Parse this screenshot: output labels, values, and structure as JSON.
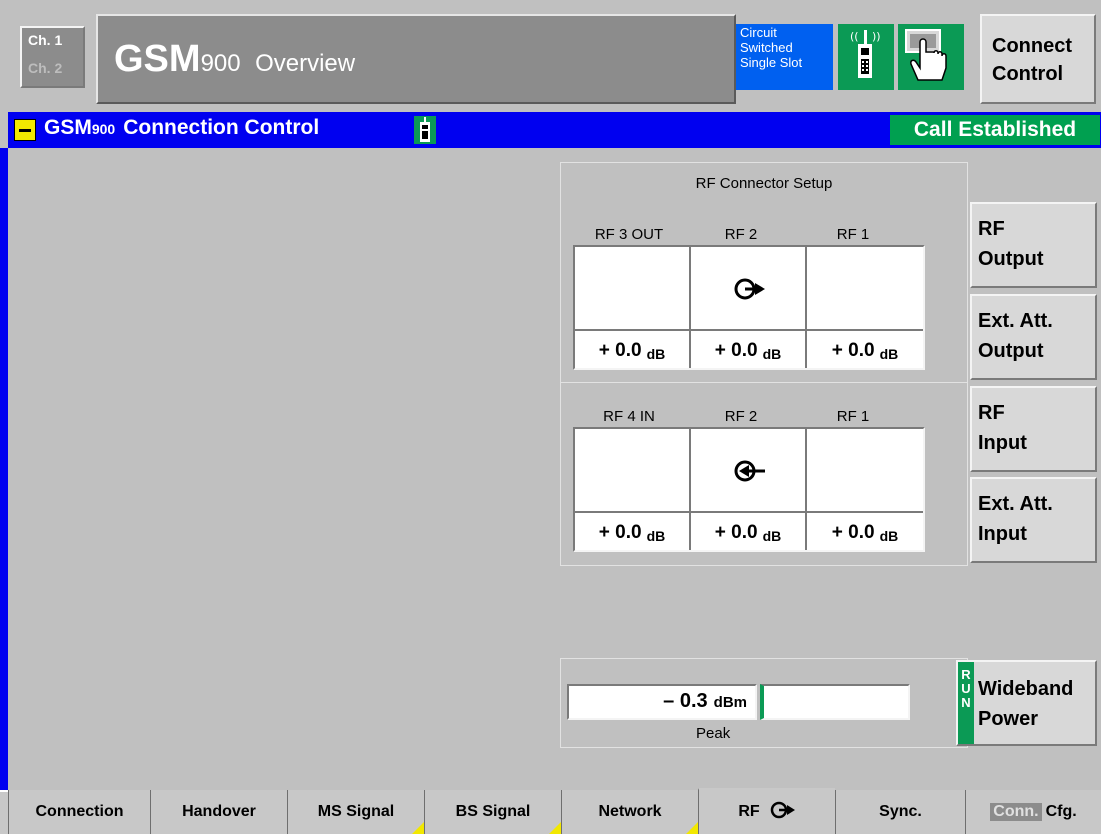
{
  "header": {
    "ch1": "Ch. 1",
    "ch2": "Ch. 2",
    "app_main": "GSM",
    "app_band": "900",
    "app_view": "Overview",
    "mode_line1": "Circuit",
    "mode_line2": "Switched",
    "mode_line3": "Single Slot",
    "connect_line1": "Connect",
    "connect_line2": "Control"
  },
  "title_bar": {
    "menu_icon": "minus-icon",
    "text_main": "GSM",
    "text_band": "900",
    "text_rest": "Connection Control",
    "status": "Call Established"
  },
  "rf_setup": {
    "title": "RF Connector Setup",
    "output": {
      "headers": [
        "RF 3 OUT",
        "RF 2",
        "RF 1"
      ],
      "values": [
        "+ 0.0",
        "+ 0.0",
        "+ 0.0"
      ],
      "unit": "dB",
      "active_connector_icon": "rf-output-connector-icon"
    },
    "input": {
      "headers": [
        "RF 4 IN",
        "RF 2",
        "RF 1"
      ],
      "values": [
        "+ 0.0",
        "+ 0.0",
        "+ 0.0"
      ],
      "unit": "dB",
      "active_connector_icon": "rf-input-connector-icon"
    }
  },
  "softkeys": {
    "rf_output": [
      "RF",
      "Output"
    ],
    "ext_att_output": [
      "Ext. Att.",
      "Output"
    ],
    "rf_input": [
      "RF",
      "Input"
    ],
    "ext_att_input": [
      "Ext. Att.",
      "Input"
    ],
    "wideband": [
      "Wideband",
      "Power"
    ],
    "run_letters": [
      "R",
      "U",
      "N"
    ]
  },
  "power": {
    "value": "– 0.3",
    "unit": "dBm",
    "label": "Peak",
    "second_value": ""
  },
  "tabs": [
    {
      "label": "Connection"
    },
    {
      "label": "Handover"
    },
    {
      "label": "MS Signal"
    },
    {
      "label": "BS Signal"
    },
    {
      "label": "Network"
    },
    {
      "label": "RF"
    },
    {
      "label": "Sync."
    },
    {
      "label_a": "Conn.",
      "label_b": "Cfg."
    }
  ],
  "colors": {
    "title_bar": "#0000f0",
    "status_green": "#00a050",
    "mode_blue": "#0060f0"
  }
}
